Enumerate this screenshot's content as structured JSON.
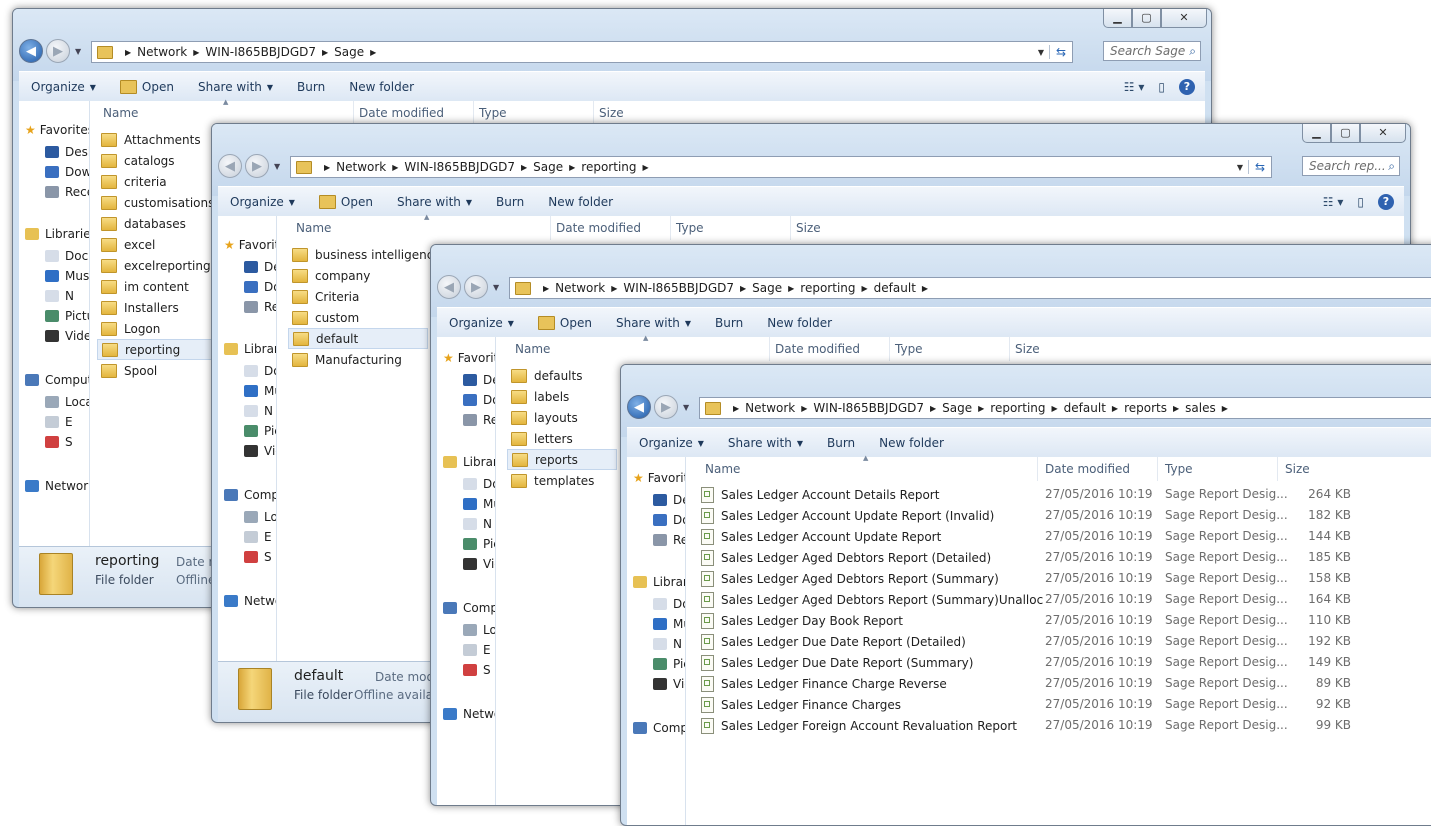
{
  "common": {
    "toolbar": {
      "organize": "Organize",
      "open": "Open",
      "share_with": "Share with",
      "burn": "Burn",
      "new_folder": "New folder"
    },
    "columns": {
      "name": "Name",
      "date_modified": "Date modified",
      "type": "Type",
      "size": "Size"
    },
    "nav": {
      "favorites": "Favorites",
      "libraries": "Libraries",
      "computer": "Computer",
      "network": "Network"
    },
    "details": {
      "file_folder": "File folder",
      "date_modified": "Date modified",
      "offline": "Offline availability"
    }
  },
  "win1": {
    "breadcrumbs": [
      "Network",
      "WIN-I865BBJDGD7",
      "Sage"
    ],
    "search_placeholder": "Search Sage",
    "folders": [
      "Attachments",
      "catalogs",
      "criteria",
      "customisations",
      "databases",
      "excel",
      "excelreporting",
      "im content",
      "Installers",
      "Logon",
      "reporting",
      "Spool"
    ],
    "selected": "reporting",
    "details_name": "reporting"
  },
  "win2": {
    "breadcrumbs": [
      "Network",
      "WIN-I865BBJDGD7",
      "Sage",
      "reporting"
    ],
    "search_placeholder": "Search rep...",
    "folders": [
      "business intelligence",
      "company",
      "Criteria",
      "custom",
      "default",
      "Manufacturing"
    ],
    "selected": "default",
    "details_name": "default"
  },
  "win3": {
    "breadcrumbs": [
      "Network",
      "WIN-I865BBJDGD7",
      "Sage",
      "reporting",
      "default"
    ],
    "folders": [
      "defaults",
      "labels",
      "layouts",
      "letters",
      "reports",
      "templates"
    ],
    "selected": "reports"
  },
  "win4": {
    "breadcrumbs": [
      "Network",
      "WIN-I865BBJDGD7",
      "Sage",
      "reporting",
      "default",
      "reports",
      "sales"
    ],
    "files": [
      {
        "name": "Sales Ledger Account Details Report",
        "date": "27/05/2016 10:19",
        "type": "Sage Report Desig...",
        "size": "264 KB"
      },
      {
        "name": "Sales Ledger Account Update Report (Invalid)",
        "date": "27/05/2016 10:19",
        "type": "Sage Report Desig...",
        "size": "182 KB"
      },
      {
        "name": "Sales Ledger Account Update Report",
        "date": "27/05/2016 10:19",
        "type": "Sage Report Desig...",
        "size": "144 KB"
      },
      {
        "name": "Sales Ledger Aged Debtors Report (Detailed)",
        "date": "27/05/2016 10:19",
        "type": "Sage Report Desig...",
        "size": "185 KB"
      },
      {
        "name": "Sales Ledger Aged Debtors Report (Summary)",
        "date": "27/05/2016 10:19",
        "type": "Sage Report Desig...",
        "size": "158 KB"
      },
      {
        "name": "Sales Ledger Aged Debtors Report (Summary)Unalloc",
        "date": "27/05/2016 10:19",
        "type": "Sage Report Desig...",
        "size": "164 KB"
      },
      {
        "name": "Sales Ledger Day Book Report",
        "date": "27/05/2016 10:19",
        "type": "Sage Report Desig...",
        "size": "110 KB"
      },
      {
        "name": "Sales Ledger Due Date Report (Detailed)",
        "date": "27/05/2016 10:19",
        "type": "Sage Report Desig...",
        "size": "192 KB"
      },
      {
        "name": "Sales Ledger Due Date Report (Summary)",
        "date": "27/05/2016 10:19",
        "type": "Sage Report Desig...",
        "size": "149 KB"
      },
      {
        "name": "Sales Ledger Finance Charge Reverse",
        "date": "27/05/2016 10:19",
        "type": "Sage Report Desig...",
        "size": "89 KB"
      },
      {
        "name": "Sales Ledger Finance Charges",
        "date": "27/05/2016 10:19",
        "type": "Sage Report Desig...",
        "size": "92 KB"
      },
      {
        "name": "Sales Ledger Foreign Account Revaluation Report",
        "date": "27/05/2016 10:19",
        "type": "Sage Report Desig...",
        "size": "99 KB"
      }
    ]
  }
}
